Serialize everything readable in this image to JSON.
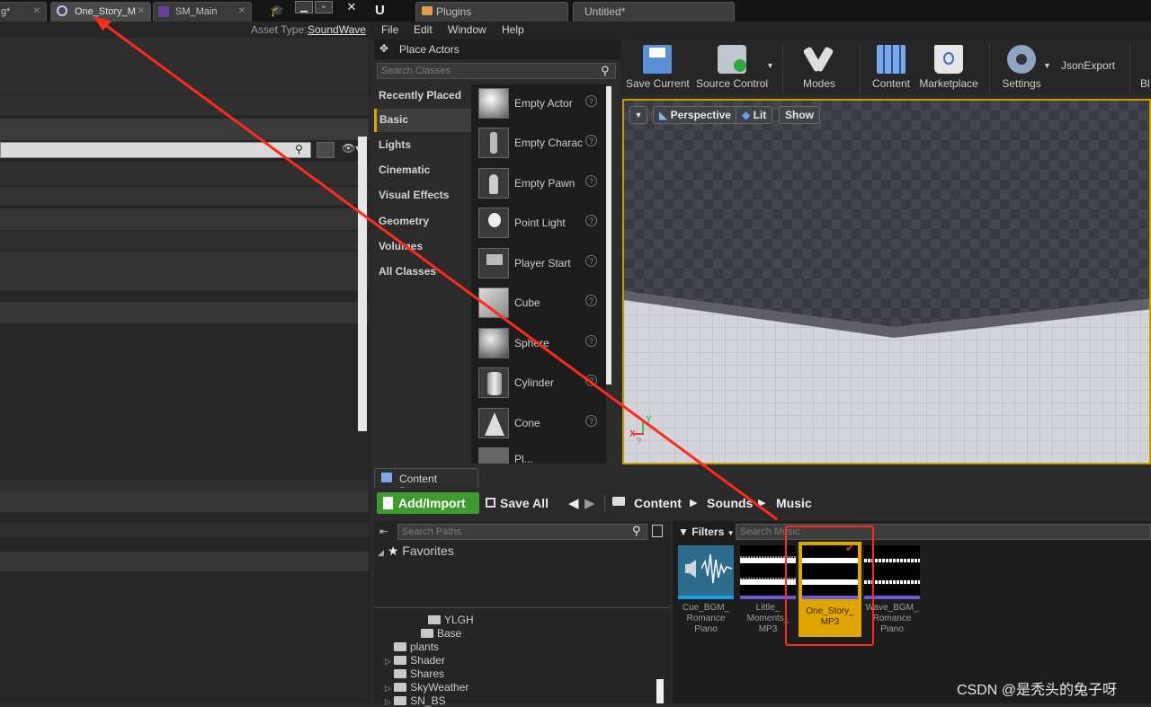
{
  "left_window": {
    "tabs": [
      {
        "label": "g*"
      },
      {
        "label": "One_Story_M"
      },
      {
        "label": "SM_Main"
      }
    ],
    "asset_type_label": "Asset Type:",
    "asset_type_value": "SoundWave"
  },
  "main_window": {
    "tabs": [
      {
        "label": "Plugins"
      },
      {
        "label": "Untitled*"
      }
    ],
    "menu": [
      "File",
      "Edit",
      "Window",
      "Help"
    ]
  },
  "place_actors": {
    "title": "Place Actors",
    "search_placeholder": "Search Classes",
    "categories": [
      "Recently Placed",
      "Basic",
      "Lights",
      "Cinematic",
      "Visual Effects",
      "Geometry",
      "Volumes",
      "All Classes"
    ],
    "selected_category": "Basic",
    "items": [
      {
        "label": "Empty Actor"
      },
      {
        "label": "Empty Charac"
      },
      {
        "label": "Empty Pawn"
      },
      {
        "label": "Point Light"
      },
      {
        "label": "Player Start"
      },
      {
        "label": "Cube"
      },
      {
        "label": "Sphere"
      },
      {
        "label": "Cylinder"
      },
      {
        "label": "Cone"
      },
      {
        "label": "Pl..."
      }
    ]
  },
  "toolbar": {
    "buttons": [
      {
        "label": "Save Current",
        "icon": "save-icon"
      },
      {
        "label": "Source Control",
        "icon": "source-control-icon"
      },
      {
        "label": "Modes",
        "icon": "modes-icon"
      },
      {
        "label": "Content",
        "icon": "content-icon"
      },
      {
        "label": "Marketplace",
        "icon": "marketplace-icon"
      },
      {
        "label": "Settings",
        "icon": "settings-icon"
      }
    ],
    "extra_label": "JsonExport",
    "cut_label": "Bl"
  },
  "viewport": {
    "perspective_label": "Perspective",
    "lit_label": "Lit",
    "show_label": "Show",
    "axis_x": "X",
    "axis_y": "Y"
  },
  "content_browser": {
    "tab_label": "Content Browser",
    "add_import_label": "Add/Import",
    "save_all_label": "Save All",
    "breadcrumb": [
      "Content",
      "Sounds",
      "Music"
    ],
    "search_paths_placeholder": "Search Paths",
    "favorites_label": "Favorites",
    "filters_label": "Filters",
    "search_assets_placeholder": "Search Music",
    "folders": [
      "YLGH",
      "Base",
      "plants",
      "Shader",
      "Shares",
      "SkyWeather",
      "SN_BS"
    ],
    "assets": [
      {
        "name": "Cue_BGM_\nRomance\nPiano",
        "kind": "sound-cue"
      },
      {
        "name": "Little_\nMoments_\nMP3",
        "kind": "sound-wave"
      },
      {
        "name": "One_Story_\nMP3",
        "kind": "sound-wave",
        "selected": true
      },
      {
        "name": "Wave_BGM_\nRomance\nPiano",
        "kind": "sound-wave"
      }
    ]
  },
  "watermark": "CSDN @是秃头的兔子呀",
  "colors": {
    "accent_yellow": "#e0a500",
    "annotation_red": "#ff2a1a",
    "add_import_green": "#3f9a2f",
    "audio_bar_purple": "#6a5bd6"
  }
}
